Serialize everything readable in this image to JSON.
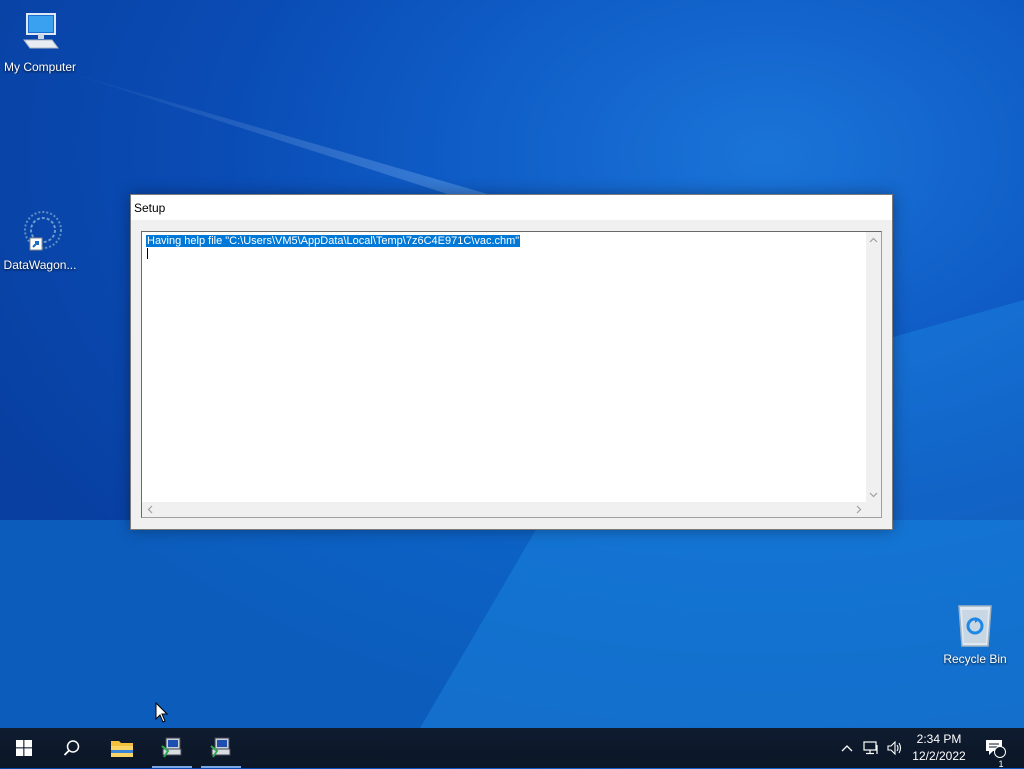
{
  "desktop": {
    "icons": [
      {
        "label": "My Computer"
      },
      {
        "label": "DataWagon..."
      },
      {
        "label": "Recycle Bin"
      }
    ]
  },
  "setup_window": {
    "title": "Setup",
    "log_line": "Having help file \"C:\\Users\\VM5\\AppData\\Local\\Temp\\7z6C4E971C\\vac.chm\"",
    "selection_color": "#0078d7"
  },
  "taskbar": {
    "items": [
      "start-icon",
      "search-icon",
      "file-explorer-icon",
      "setup-app-icon",
      "setup-app-icon"
    ],
    "clock_time": "2:34 PM",
    "clock_date": "12/2/2022",
    "notification_count": "1"
  },
  "colors": {
    "desktop_blue": "#0f5cc6",
    "taskbar": "#0b1626",
    "accent": "#0078d7"
  }
}
